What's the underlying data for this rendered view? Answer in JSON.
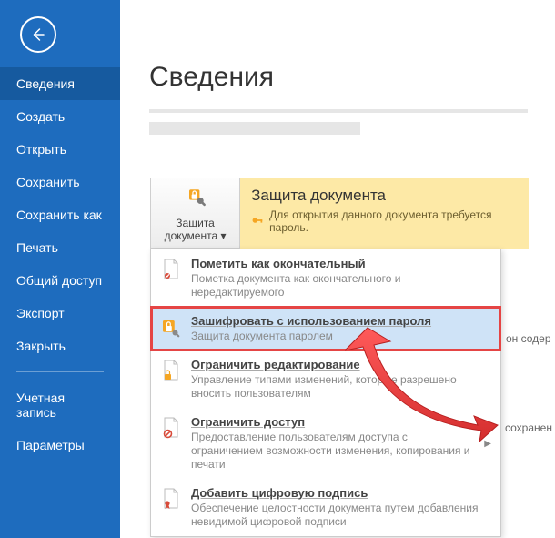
{
  "sidebar": {
    "items": [
      {
        "label": "Сведения",
        "active": true
      },
      {
        "label": "Создать"
      },
      {
        "label": "Открыть"
      },
      {
        "label": "Сохранить"
      },
      {
        "label": "Сохранить как"
      },
      {
        "label": "Печать"
      },
      {
        "label": "Общий доступ"
      },
      {
        "label": "Экспорт"
      },
      {
        "label": "Закрыть"
      }
    ],
    "footer_items": [
      {
        "label": "Учетная запись"
      },
      {
        "label": "Параметры"
      }
    ]
  },
  "page": {
    "title": "Сведения"
  },
  "protect": {
    "button_line1": "Защита",
    "button_line2": "документа",
    "heading": "Защита документа",
    "subtext": "Для открытия данного документа требуется пароль."
  },
  "menu": {
    "items": [
      {
        "title": "Пометить как окончательный",
        "desc": "Пометка документа как окончательного и нередактируемого"
      },
      {
        "title": "Зашифровать с использованием пароля",
        "desc": "Защита документа паролем"
      },
      {
        "title": "Ограничить редактирование",
        "desc": "Управление типами изменений, которые разрешено вносить пользователям"
      },
      {
        "title": "Ограничить доступ",
        "desc": "Предоставление пользователям доступа с ограничением возможности изменения, копирования и печати"
      },
      {
        "title": "Добавить цифровую подпись",
        "desc": "Обеспечение целостности документа путем добавления невидимой цифровой подписи"
      }
    ]
  },
  "side_fragments": {
    "frag1": "он содер",
    "frag2": "сохранен"
  }
}
